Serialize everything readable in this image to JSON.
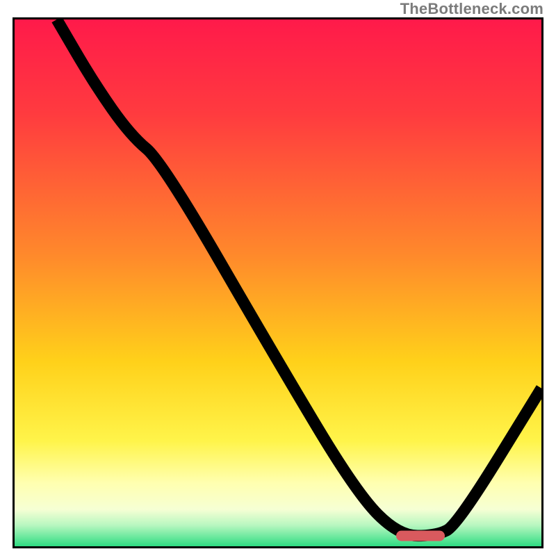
{
  "watermark": "TheBottleneck.com",
  "marker": {
    "x_pct": 77,
    "y_pct": 98,
    "color": "#d95a5e"
  },
  "gradient_stops": [
    {
      "offset": 0,
      "color": "#ff1a4a"
    },
    {
      "offset": 18,
      "color": "#ff3b3f"
    },
    {
      "offset": 45,
      "color": "#ff8a2b"
    },
    {
      "offset": 65,
      "color": "#ffd11a"
    },
    {
      "offset": 80,
      "color": "#fff44a"
    },
    {
      "offset": 88,
      "color": "#ffffb0"
    },
    {
      "offset": 93,
      "color": "#f6ffd4"
    },
    {
      "offset": 96,
      "color": "#b8f7c0"
    },
    {
      "offset": 100,
      "color": "#2edc82"
    }
  ],
  "chart_data": {
    "type": "line",
    "title": "",
    "xlabel": "",
    "ylabel": "",
    "xlim": [
      0,
      100
    ],
    "ylim": [
      0,
      100
    ],
    "x": [
      8,
      15,
      22,
      28,
      50,
      65,
      73,
      80,
      84,
      100
    ],
    "values": [
      100,
      88,
      78,
      73,
      35,
      10,
      2,
      2,
      4,
      30
    ],
    "note": "y=0 bottom (green), y=100 top (red). Curve descends from top-left, has a knee ~x=28, drops steeply to a flat trough ~x=73–80 near the bottom, then rises toward the right edge."
  }
}
